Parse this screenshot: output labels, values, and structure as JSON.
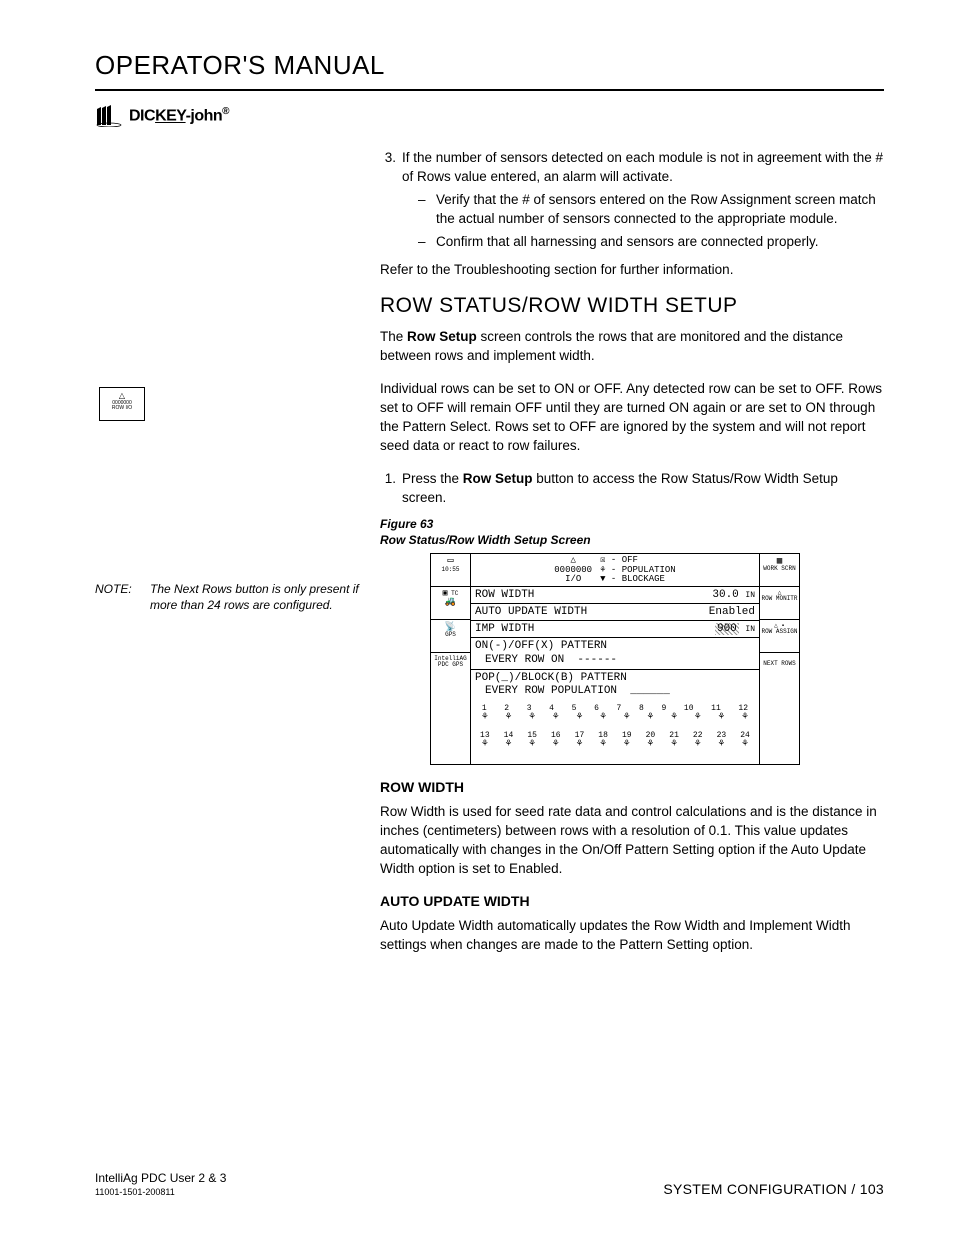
{
  "header": {
    "title": "OPERATOR'S MANUAL",
    "brand_prefix": "DIC",
    "brand_key": "KEY",
    "brand_suffix": "-john",
    "brand_reg": "®"
  },
  "content": {
    "list3_num": "3.",
    "list3_text": "If the number of sensors detected on each module is not in agreement with the # of Rows value entered, an alarm will activate.",
    "dash_a": "Verify that the # of sensors entered on the Row Assignment screen match the actual number of sensors connected to the appropriate module.",
    "dash_b": "Confirm that all harnessing and sensors are connected properly.",
    "refer": "Refer to the Troubleshooting section for further information.",
    "h2_row_status": "ROW STATUS/ROW WIDTH SETUP",
    "p_row_setup_1a": "The ",
    "p_row_setup_1b": "Row Setup",
    "p_row_setup_1c": " screen controls the rows that are monitored and the distance between rows and implement width.",
    "p_row_setup_2": "Individual rows can be set to ON or OFF. Any detected row can be set to OFF. Rows set to OFF will remain OFF until they are turned ON again or are set to ON through the Pattern Select. Rows set to OFF are ignored by the system and will not report seed data or react to row failures.",
    "list1_num": "1.",
    "list1_a": "Press the ",
    "list1_b": "Row Setup",
    "list1_c": " button to access the Row Status/Row Width Setup screen.",
    "figure_label": "Figure 63",
    "figure_caption": "Row Status/Row Width Setup Screen",
    "h3_row_width": "ROW WIDTH",
    "p_row_width": "Row Width is used for seed rate data and control calculations and is the distance in inches (centimeters) between rows with a resolution of 0.1. This value updates automatically with changes in the On/Off Pattern Setting option if the Auto Update Width option is set to Enabled.",
    "h3_auto_update": "AUTO UPDATE WIDTH",
    "p_auto_update": "Auto Update Width automatically updates the Row Width and Implement Width settings when changes are made to the Pattern Setting option."
  },
  "side": {
    "icon_line1": "0000000",
    "icon_line2": "ROW I/O",
    "note_label": "NOTE:",
    "note_text": "The Next Rows button is only present if more than 24 rows are configured."
  },
  "screen": {
    "time": "10:55",
    "top_code": "0000000",
    "top_io": "I/O",
    "legend_off": "OFF",
    "legend_pop": "POPULATION",
    "legend_block": "BLOCKAGE",
    "row_width_label": "ROW WIDTH",
    "row_width_val": "30.0",
    "row_width_unit": "IN",
    "auto_update_label": "AUTO UPDATE WIDTH",
    "auto_update_val": "Enabled",
    "imp_width_label": "IMP WIDTH",
    "imp_width_val": "900",
    "imp_width_unit": "IN",
    "onoff_title": "ON(-)/OFF(X) PATTERN",
    "onoff_sub": "EVERY ROW ON",
    "onoff_dashes": "------",
    "popblock_title": "POP(_)/BLOCK(B) PATTERN",
    "popblock_sub": "EVERY ROW POPULATION",
    "popblock_dashes": "______",
    "row_nums_1": [
      "1",
      "2",
      "3",
      "4",
      "5",
      "6",
      "7",
      "8",
      "9",
      "10",
      "11",
      "12"
    ],
    "row_nums_2": [
      "13",
      "14",
      "15",
      "16",
      "17",
      "18",
      "19",
      "20",
      "21",
      "22",
      "23",
      "24"
    ],
    "right_labels": {
      "work": "WORK SCRN",
      "row_monitr": "ROW MONITR",
      "row_assign": "ROW ASSIGN",
      "next_rows": "NEXT ROWS"
    },
    "left_labels": {
      "tc": "TC",
      "gps": "GPS",
      "intelliag": "IntelliAG",
      "pdc": "PDC GPS"
    }
  },
  "footer": {
    "left1": "IntelliAg PDC User 2 & 3",
    "left2": "11001-1501-200811",
    "right": "SYSTEM CONFIGURATION / 103"
  }
}
